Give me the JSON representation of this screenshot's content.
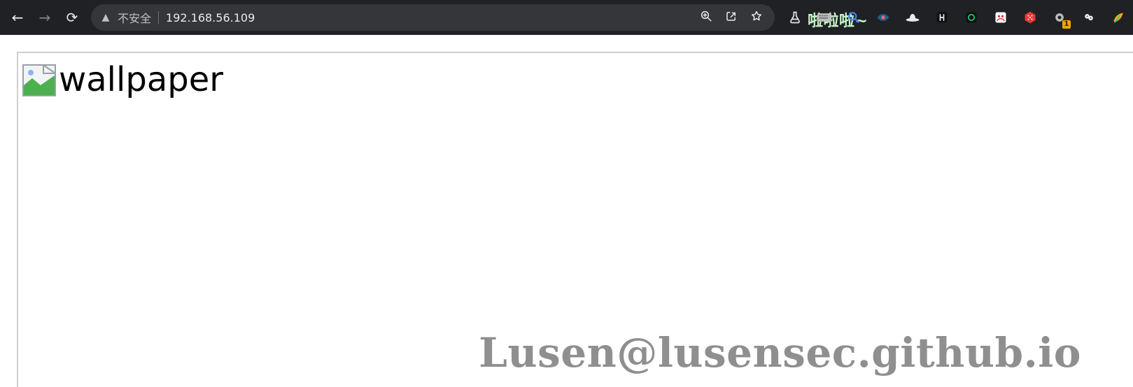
{
  "browser": {
    "security_label": "不安全",
    "url": "192.168.56.109",
    "extension_overlay_text": "啦啦啦~",
    "extensions": [
      {
        "name": "flask",
        "label": ""
      },
      {
        "name": "keyboard",
        "label": ""
      },
      {
        "name": "magnifier",
        "label": ""
      },
      {
        "name": "eye",
        "label": ""
      },
      {
        "name": "hat",
        "label": ""
      },
      {
        "name": "h-square",
        "label": ""
      },
      {
        "name": "circle-square",
        "label": ""
      },
      {
        "name": "people",
        "label": ""
      },
      {
        "name": "dice",
        "label": ""
      },
      {
        "name": "gear-badge",
        "badge": "1"
      },
      {
        "name": "cookies",
        "label": ""
      },
      {
        "name": "colorful",
        "label": ""
      }
    ]
  },
  "page": {
    "image_alt": "wallpaper",
    "watermark": "Lusen@lusensec.github.io"
  },
  "colors": {
    "chrome_bg": "#202124",
    "omnibox_bg": "#35363a",
    "page_bg": "#ffffff",
    "frame_border": "#cfcfcf",
    "watermark": "#8a8a8a",
    "extension_text": "#c7f4c9"
  }
}
